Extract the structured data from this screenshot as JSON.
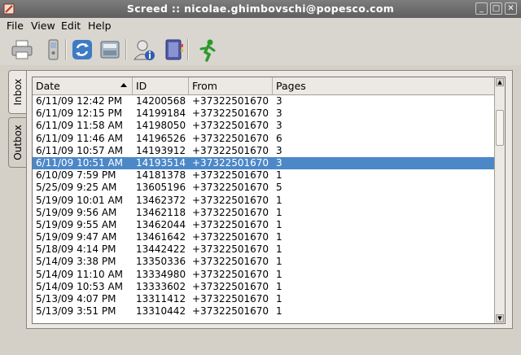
{
  "window": {
    "title": "Screed :: nicolae.ghimbovschi@popesco.com"
  },
  "menu": [
    "File",
    "View",
    "Edit",
    "Help"
  ],
  "toolbar": [
    "printer-icon",
    "phone-icon",
    "refresh-icon",
    "fax-icon",
    "user-info-icon",
    "address-book-icon",
    "exit-run-icon"
  ],
  "tabs": {
    "inbox": "Inbox",
    "outbox": "Outbox"
  },
  "columns": {
    "date": "Date",
    "id": "ID",
    "from": "From",
    "pages": "Pages"
  },
  "rows": [
    {
      "date": "6/11/09 12:42 PM",
      "id": "14200568",
      "from": "+37322501670",
      "pages": "3"
    },
    {
      "date": "6/11/09 12:15 PM",
      "id": "14199184",
      "from": "+37322501670",
      "pages": "3"
    },
    {
      "date": "6/11/09 11:58 AM",
      "id": "14198050",
      "from": "+37322501670",
      "pages": "3"
    },
    {
      "date": "6/11/09 11:46 AM",
      "id": "14196526",
      "from": "+37322501670",
      "pages": "6"
    },
    {
      "date": "6/11/09 10:57 AM",
      "id": "14193912",
      "from": "+37322501670",
      "pages": "3"
    },
    {
      "date": "6/11/09 10:51 AM",
      "id": "14193514",
      "from": "+37322501670",
      "pages": "3",
      "selected": true
    },
    {
      "date": "6/10/09 7:59 PM",
      "id": "14181378",
      "from": "+37322501670",
      "pages": "1"
    },
    {
      "date": "5/25/09 9:25 AM",
      "id": "13605196",
      "from": "+37322501670",
      "pages": "5"
    },
    {
      "date": "5/19/09 10:01 AM",
      "id": "13462372",
      "from": "+37322501670",
      "pages": "1"
    },
    {
      "date": "5/19/09 9:56 AM",
      "id": "13462118",
      "from": "+37322501670",
      "pages": "1"
    },
    {
      "date": "5/19/09 9:55 AM",
      "id": "13462044",
      "from": "+37322501670",
      "pages": "1"
    },
    {
      "date": "5/19/09 9:47 AM",
      "id": "13461642",
      "from": "+37322501670",
      "pages": "1"
    },
    {
      "date": "5/18/09 4:14 PM",
      "id": "13442422",
      "from": "+37322501670",
      "pages": "1"
    },
    {
      "date": "5/14/09 3:38 PM",
      "id": "13350336",
      "from": "+37322501670",
      "pages": "1"
    },
    {
      "date": "5/14/09 11:10 AM",
      "id": "13334980",
      "from": "+37322501670",
      "pages": "1"
    },
    {
      "date": "5/14/09 10:53 AM",
      "id": "13333602",
      "from": "+37322501670",
      "pages": "1"
    },
    {
      "date": "5/13/09 4:07 PM",
      "id": "13311412",
      "from": "+37322501670",
      "pages": "1"
    },
    {
      "date": "5/13/09 3:51 PM",
      "id": "13310442",
      "from": "+37322501670",
      "pages": "1"
    }
  ]
}
